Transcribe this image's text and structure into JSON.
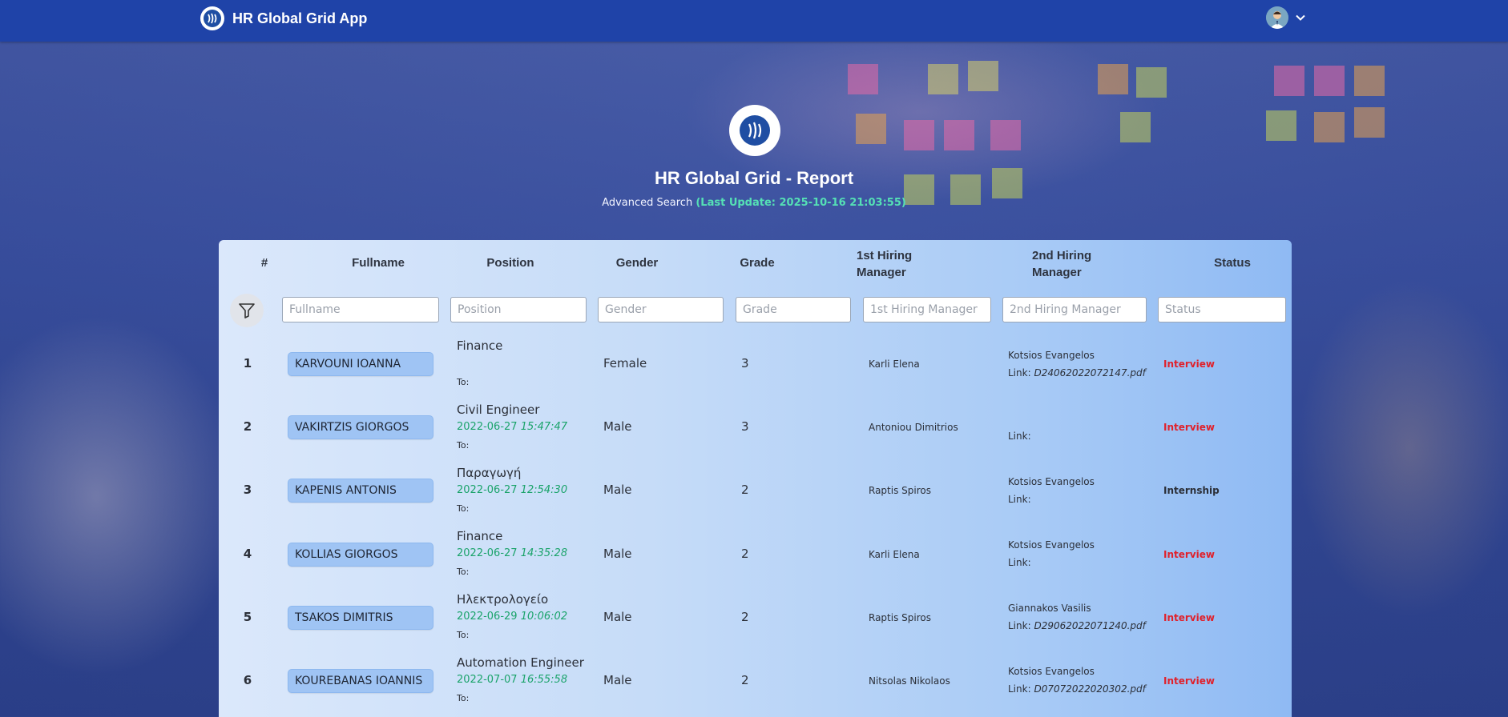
{
  "app": {
    "title": "HR Global Grid App"
  },
  "hero": {
    "title": "HR Global Grid - Report",
    "subtitle_prefix": "Advanced Search",
    "last_update": "(Last Update: 2025-10-16 21:03:55)"
  },
  "table": {
    "headers": {
      "num": "#",
      "fullname": "Fullname",
      "position": "Position",
      "gender": "Gender",
      "grade": "Grade",
      "hm1_line1": "1st Hiring",
      "hm1_line2": "Manager",
      "hm2_line1": "2nd Hiring",
      "hm2_line2": "Manager",
      "status": "Status"
    },
    "filters": {
      "fullname": "Fullname",
      "position": "Position",
      "gender": "Gender",
      "grade": "Grade",
      "hm1": "1st Hiring Manager",
      "hm2": "2nd Hiring Manager",
      "status": "Status"
    },
    "to_label": "To:",
    "link_label": "Link:",
    "rows": [
      {
        "num": "1",
        "name": "KARVOUNI IOANNA",
        "position": "Finance",
        "date": "",
        "time": "",
        "gender": "Female",
        "grade": "3",
        "hm1": "Karli Elena",
        "hm2": "Kotsios Evangelos",
        "link": "D24062022072147.pdf",
        "status": "Interview"
      },
      {
        "num": "2",
        "name": "VAKIRTZIS GIORGOS",
        "position": "Civil Engineer",
        "date": "2022-06-27",
        "time": "15:47:47",
        "gender": "Male",
        "grade": "3",
        "hm1": "Antoniou Dimitrios",
        "hm2": "",
        "link": "",
        "status": "Interview"
      },
      {
        "num": "3",
        "name": "KAPENIS ANTONIS",
        "position": "Παραγωγή",
        "date": "2022-06-27",
        "time": "12:54:30",
        "gender": "Male",
        "grade": "2",
        "hm1": "Raptis Spiros",
        "hm2": "Kotsios Evangelos",
        "link": "",
        "status": "Internship"
      },
      {
        "num": "4",
        "name": "KOLLIAS GIORGOS",
        "position": "Finance",
        "date": "2022-06-27",
        "time": "14:35:28",
        "gender": "Male",
        "grade": "2",
        "hm1": "Karli Elena",
        "hm2": "Kotsios Evangelos",
        "link": "",
        "status": "Interview"
      },
      {
        "num": "5",
        "name": "TSAKOS DIMITRIS",
        "position": "Ηλεκτρολογείο",
        "date": "2022-06-29",
        "time": "10:06:02",
        "gender": "Male",
        "grade": "2",
        "hm1": "Raptis Spiros",
        "hm2": "Giannakos Vasilis",
        "link": "D29062022071240.pdf",
        "status": "Interview"
      },
      {
        "num": "6",
        "name": "KOUREBANAS IOANNIS",
        "position": "Automation Engineer",
        "date": "2022-07-07",
        "time": "16:55:58",
        "gender": "Male",
        "grade": "2",
        "hm1": "Nitsolas Nikolaos",
        "hm2": "Kotsios Evangelos",
        "link": "D07072022020302.pdf",
        "status": "Interview"
      }
    ]
  },
  "colors": {
    "header_bg": "#1f43a8",
    "interview": "#e0212b",
    "internship": "#2b2f38",
    "date_green": "#1aa36a",
    "update_green": "#55e0b5"
  },
  "icons": {
    "app_logo": "waves-logo-icon",
    "user": "user-avatar-icon",
    "dropdown": "chevron-down-icon",
    "filter": "filter-icon"
  }
}
